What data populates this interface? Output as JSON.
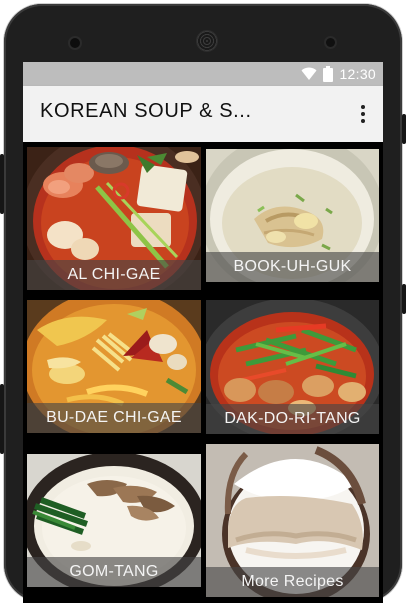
{
  "status_bar": {
    "time": "12:30",
    "icons": [
      "wifi-icon",
      "battery-icon"
    ]
  },
  "app_bar": {
    "title": "KOREAN SOUP & S...",
    "menu_icon": "overflow-menu-icon"
  },
  "recipes": [
    {
      "label": "AL CHI-GAE"
    },
    {
      "label": "BOOK-UH-GUK"
    },
    {
      "label": "BU-DAE CHI-GAE"
    },
    {
      "label": "DAK-DO-RI-TANG"
    },
    {
      "label": "GOM-TANG"
    },
    {
      "label": "More Recipes"
    }
  ],
  "colors": {
    "status_bar": "#bdbdbd",
    "app_bar": "#f2f2f2",
    "caption_overlay": "#464646"
  }
}
